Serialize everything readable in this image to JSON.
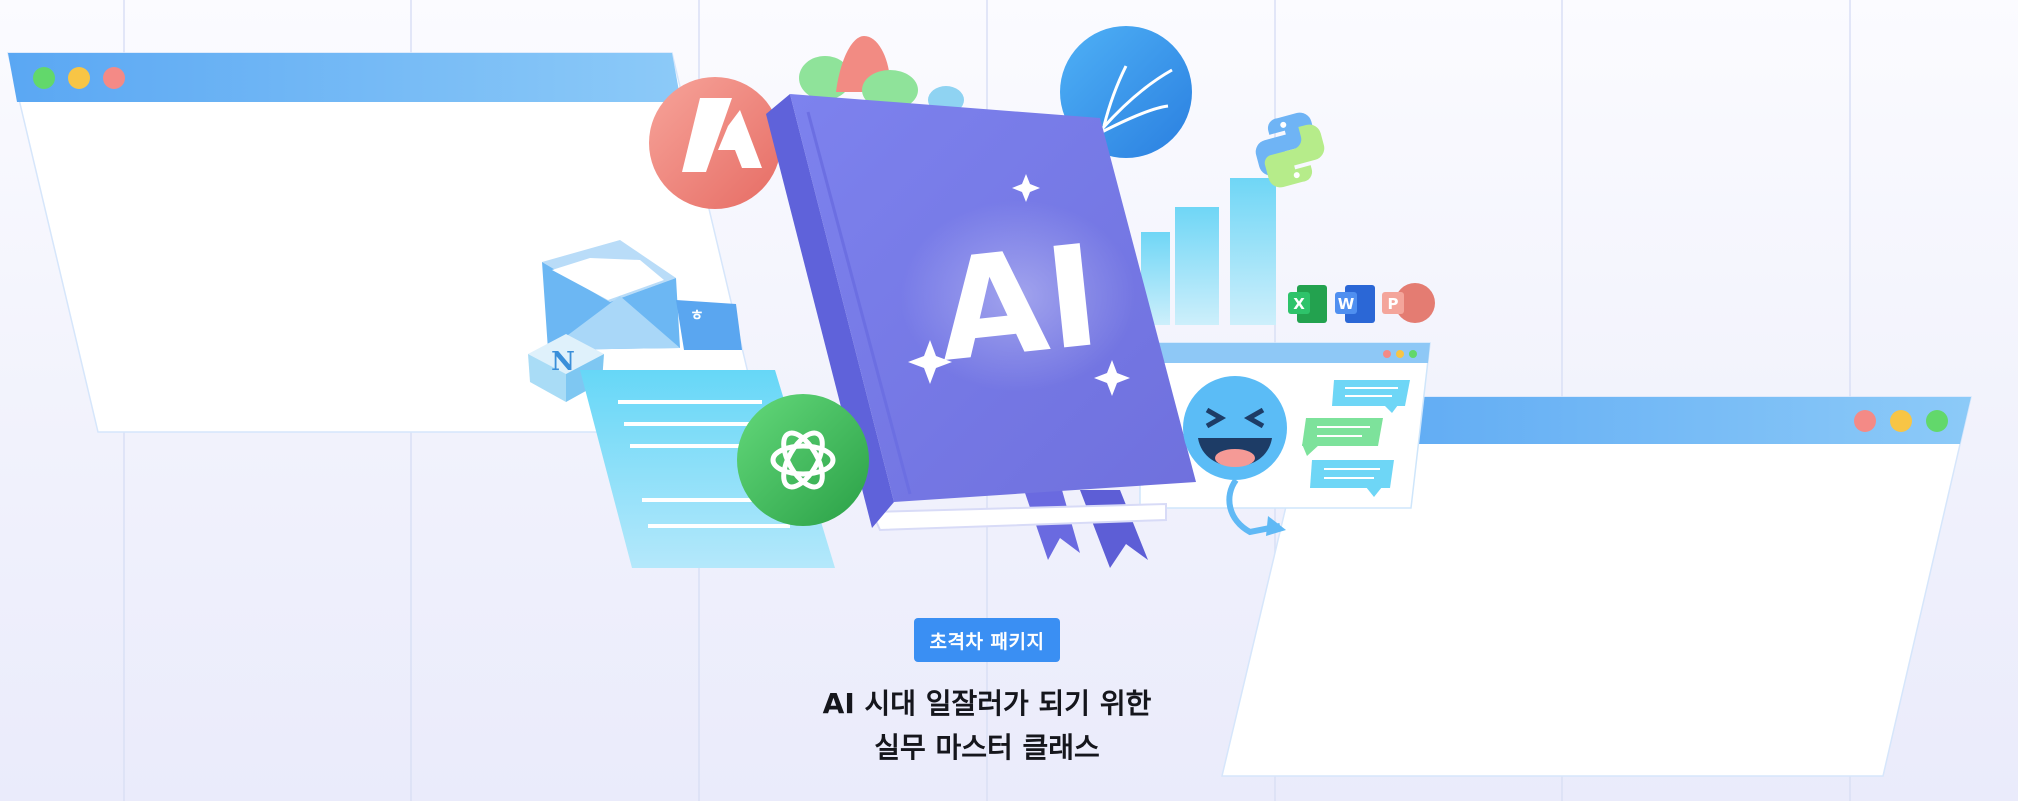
{
  "hero": {
    "badge_label": "초격차 패키지",
    "headline_line1": "AI 시대 일잘러가 되기 위한",
    "headline_line2": "실무 마스터 클래스"
  },
  "book": {
    "cover_text": "AI"
  },
  "office_icons": {
    "excel": "X",
    "word": "W",
    "powerpoint": "P"
  },
  "notion_letter": "N",
  "colors": {
    "accent_blue": "#3a8ff3",
    "book_purple": "#7b7fe8",
    "window_header": "#6ab3f5",
    "chatgpt_green": "#3fbf5a",
    "coral": "#f3877e"
  },
  "icons": [
    "window-dots-icon",
    "adobe-firefly-icon",
    "feather-icon",
    "python-icon",
    "bar-chart-icon",
    "envelope-icon",
    "notion-icon",
    "chatgpt-icon",
    "document-icon",
    "laughing-emoji-icon",
    "chat-bubble-icon",
    "excel-icon",
    "word-icon",
    "powerpoint-icon",
    "sparkle-icon"
  ]
}
